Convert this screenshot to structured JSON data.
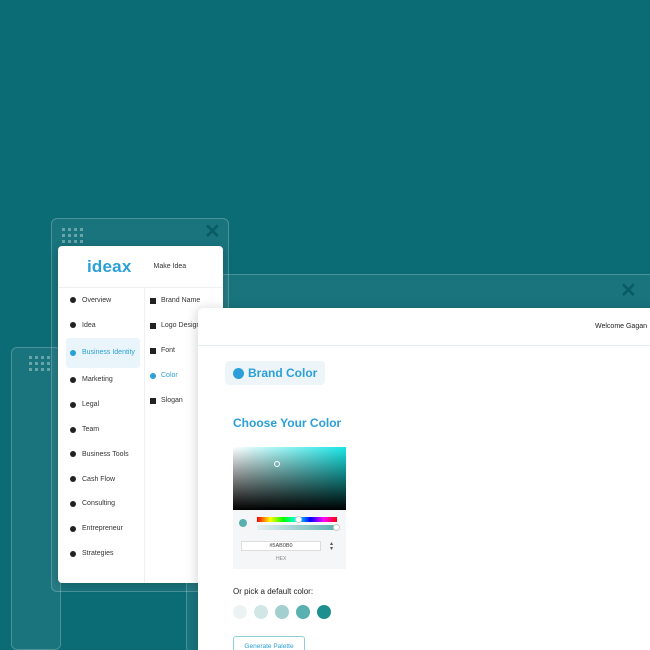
{
  "app": {
    "logo": "ideax",
    "top_menu": "Make Idea"
  },
  "sidebar": {
    "items": [
      {
        "label": "Overview",
        "icon": "eye-icon"
      },
      {
        "label": "Idea",
        "icon": "bulb-icon"
      },
      {
        "label": "Business Identity",
        "icon": "cloud-icon",
        "active": true
      },
      {
        "label": "Marketing",
        "icon": "compass-icon"
      },
      {
        "label": "Legal",
        "icon": "scales-icon"
      },
      {
        "label": "Team",
        "icon": "team-icon"
      },
      {
        "label": "Business Tools",
        "icon": "tools-icon"
      },
      {
        "label": "Cash Flow",
        "icon": "cash-icon"
      },
      {
        "label": "Consulting",
        "icon": "handshake-icon"
      },
      {
        "label": "Entrepreneur",
        "icon": "briefcase-icon"
      },
      {
        "label": "Strategies",
        "icon": "refresh-icon"
      }
    ]
  },
  "submenu": {
    "items": [
      {
        "label": "Brand Name",
        "icon": "book-icon"
      },
      {
        "label": "Logo Design",
        "icon": "people-icon"
      },
      {
        "label": "Font",
        "icon": "font-icon"
      },
      {
        "label": "Color",
        "icon": "palette-icon",
        "active": true
      },
      {
        "label": "Slogan",
        "icon": "text-icon"
      }
    ]
  },
  "header": {
    "welcome": "Welcome Gagan"
  },
  "main": {
    "chip_title": "Brand Color",
    "heading": "Choose Your Color",
    "picker": {
      "hex_value": "#5AB0B0",
      "hex_label": "HEX"
    },
    "default_label": "Or pick a default color:",
    "default_colors": [
      "#edf3f3",
      "#d2e6e6",
      "#a3cfcf",
      "#5ab0b0",
      "#1e8f8f"
    ],
    "generate_label": "Generate Palette"
  },
  "colors": {
    "background": "#0b6c76",
    "accent": "#2a9fd8"
  }
}
